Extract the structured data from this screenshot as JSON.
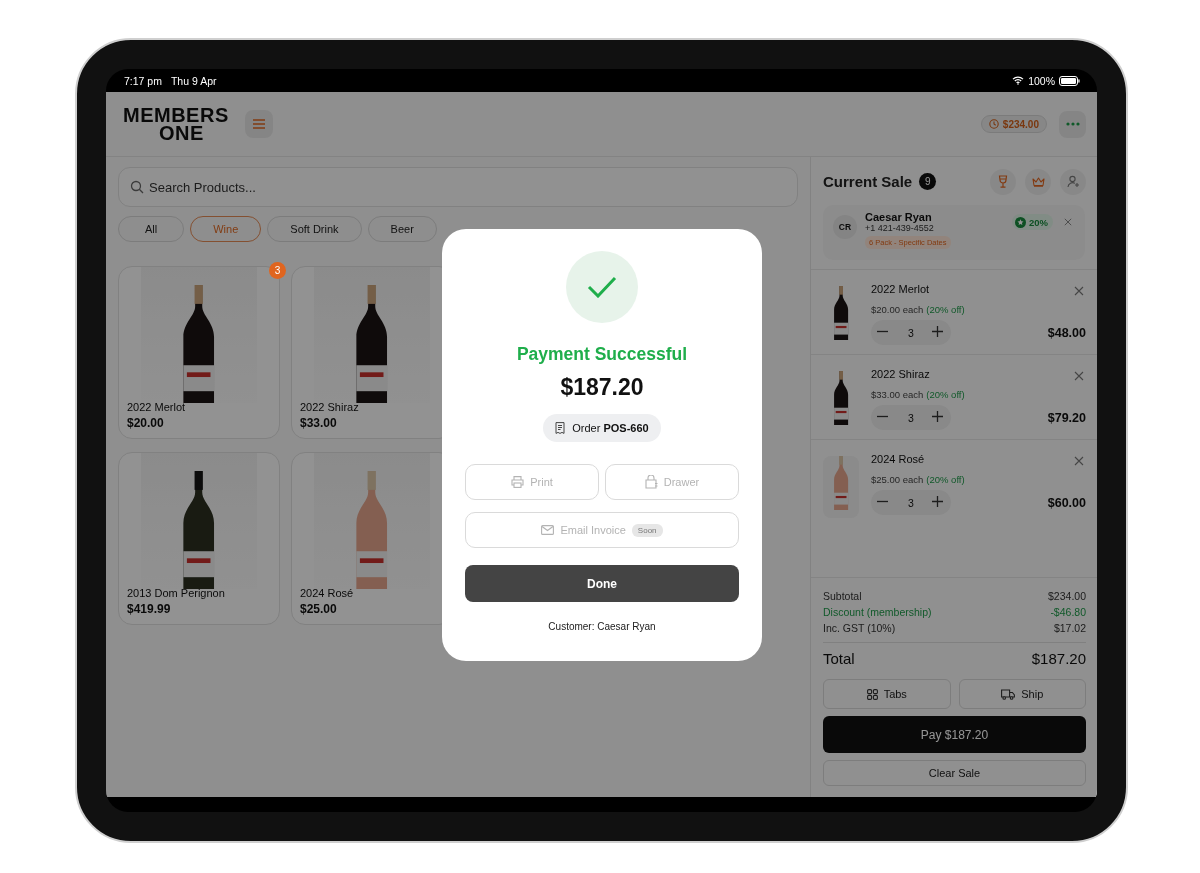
{
  "status_bar": {
    "time": "7:17 pm",
    "date": "Thu 9 Apr",
    "battery": "100%"
  },
  "header": {
    "logo": [
      "MEMBERS",
      "ONE"
    ],
    "pending_total": "$234.00"
  },
  "search": {
    "placeholder": "Search Products..."
  },
  "categories": [
    {
      "label": "All",
      "selected": false
    },
    {
      "label": "Wine",
      "selected": true
    },
    {
      "label": "Soft Drink",
      "selected": false
    },
    {
      "label": "Beer",
      "selected": false
    }
  ],
  "products": [
    {
      "name": "2022 Merlot",
      "price": "$20.00",
      "kind": "red",
      "badge": "3"
    },
    {
      "name": "2022 Shiraz",
      "price": "$33.00",
      "kind": "red"
    },
    {
      "name": "2013 Dom Perignon",
      "price": "$419.99",
      "kind": "sparkling"
    },
    {
      "name": "2024 Rosé",
      "price": "$25.00",
      "kind": "rose"
    }
  ],
  "sale": {
    "title": "Current Sale",
    "count": "9",
    "customer": {
      "initials": "CR",
      "name": "Caesar Ryan",
      "phone": "+1 421-439-4552",
      "membership": "6 Pack - Specific Dates",
      "discount": "20%"
    },
    "items": [
      {
        "name": "2022 Merlot",
        "unit_price": "$20.00 each",
        "discount_note": "(20% off)",
        "quantity": "3",
        "total": "$48.00",
        "kind": "red"
      },
      {
        "name": "2022 Shiraz",
        "unit_price": "$33.00 each",
        "discount_note": "(20% off)",
        "quantity": "3",
        "total": "$79.20",
        "kind": "red"
      },
      {
        "name": "2024 Rosé",
        "unit_price": "$25.00 each",
        "discount_note": "(20% off)",
        "quantity": "3",
        "total": "$60.00",
        "kind": "rose"
      }
    ],
    "summary": [
      {
        "label": "Subtotal",
        "value": "$234.00",
        "kind": "normal"
      },
      {
        "label": "Discount (membership)",
        "value": "-$46.80",
        "kind": "discount"
      },
      {
        "label": "Inc. GST (10%)",
        "value": "$17.02",
        "kind": "normal"
      }
    ],
    "total": {
      "label": "Total",
      "value": "$187.20"
    },
    "actions": [
      {
        "label": "Tabs",
        "kind": "tabs"
      },
      {
        "label": "Ship",
        "kind": "ship"
      }
    ],
    "pay_button": "Pay $187.20",
    "clear_button": "Clear Sale"
  },
  "dialog": {
    "title": "Payment Successful",
    "amount": "$187.20",
    "order": "Order **POS-660**",
    "buttons": [
      {
        "label": "Print",
        "kind": "print",
        "disabled": true
      },
      {
        "label": "Drawer",
        "kind": "drawer",
        "disabled": true
      },
      {
        "label": "Email Invoice",
        "kind": "email",
        "disabled": true,
        "badge": "Soon"
      }
    ],
    "done_button": "Done",
    "customer_line": "Customer: Caesar Ryan"
  }
}
